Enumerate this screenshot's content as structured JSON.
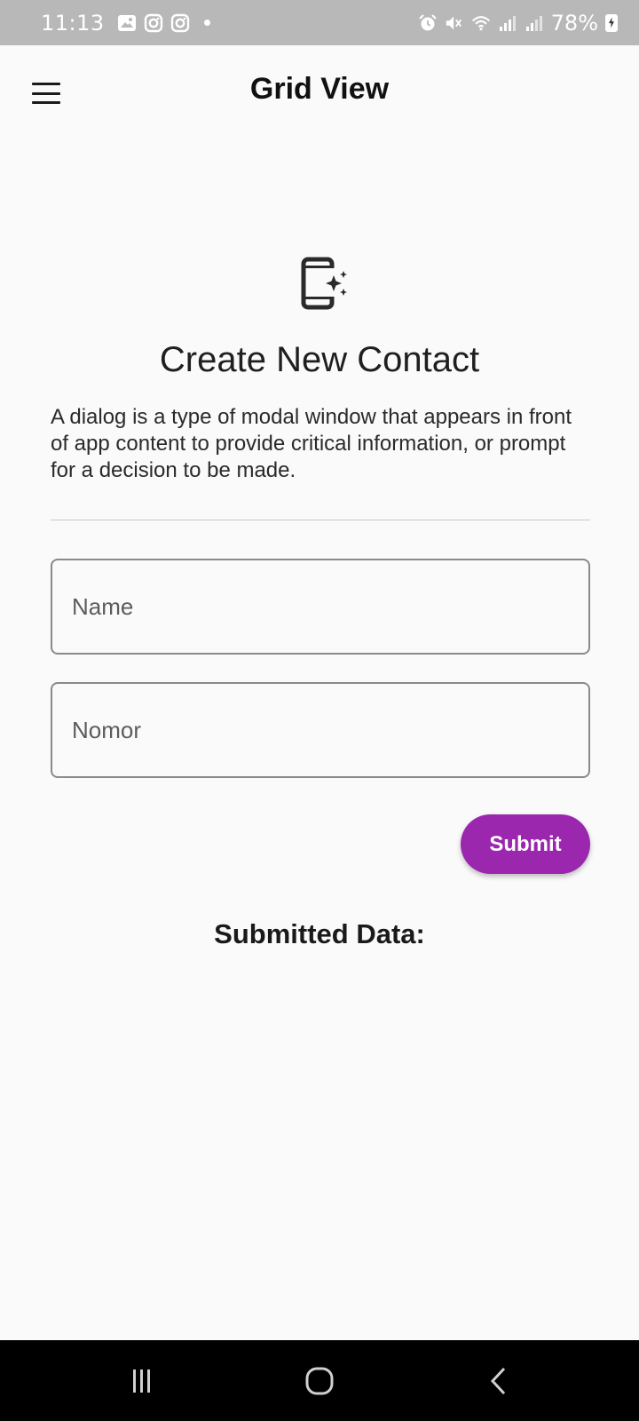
{
  "status_bar": {
    "time": "11:13",
    "battery": "78%",
    "left_icons": [
      "gallery-icon",
      "instagram-icon",
      "instagram-icon",
      "notification-dot"
    ],
    "right_icons": [
      "alarm-icon",
      "mute-icon",
      "wifi-icon",
      "signal-icon",
      "signal-icon",
      "battery-icon"
    ]
  },
  "app_bar": {
    "title": "Grid View",
    "menu_icon": "hamburger-menu-icon"
  },
  "dialog": {
    "icon": "phone-sparkle-icon",
    "title": "Create New Contact",
    "body": "A dialog is a type of modal window that appears in front of app content to provide critical information, or prompt for a decision to be made."
  },
  "form": {
    "name_field": {
      "value": "",
      "placeholder": "Name"
    },
    "nomor_field": {
      "value": "",
      "placeholder": "Nomor"
    },
    "submit_label": "Submit"
  },
  "submitted": {
    "label": "Submitted Data:"
  },
  "nav_bar": {
    "icons": [
      "recent-apps-icon",
      "home-icon",
      "back-icon"
    ]
  },
  "colors": {
    "accent": "#9b27af",
    "status_bar_bg": "#b8b8b8",
    "background": "#fafafa",
    "nav_bar_bg": "#000000"
  }
}
